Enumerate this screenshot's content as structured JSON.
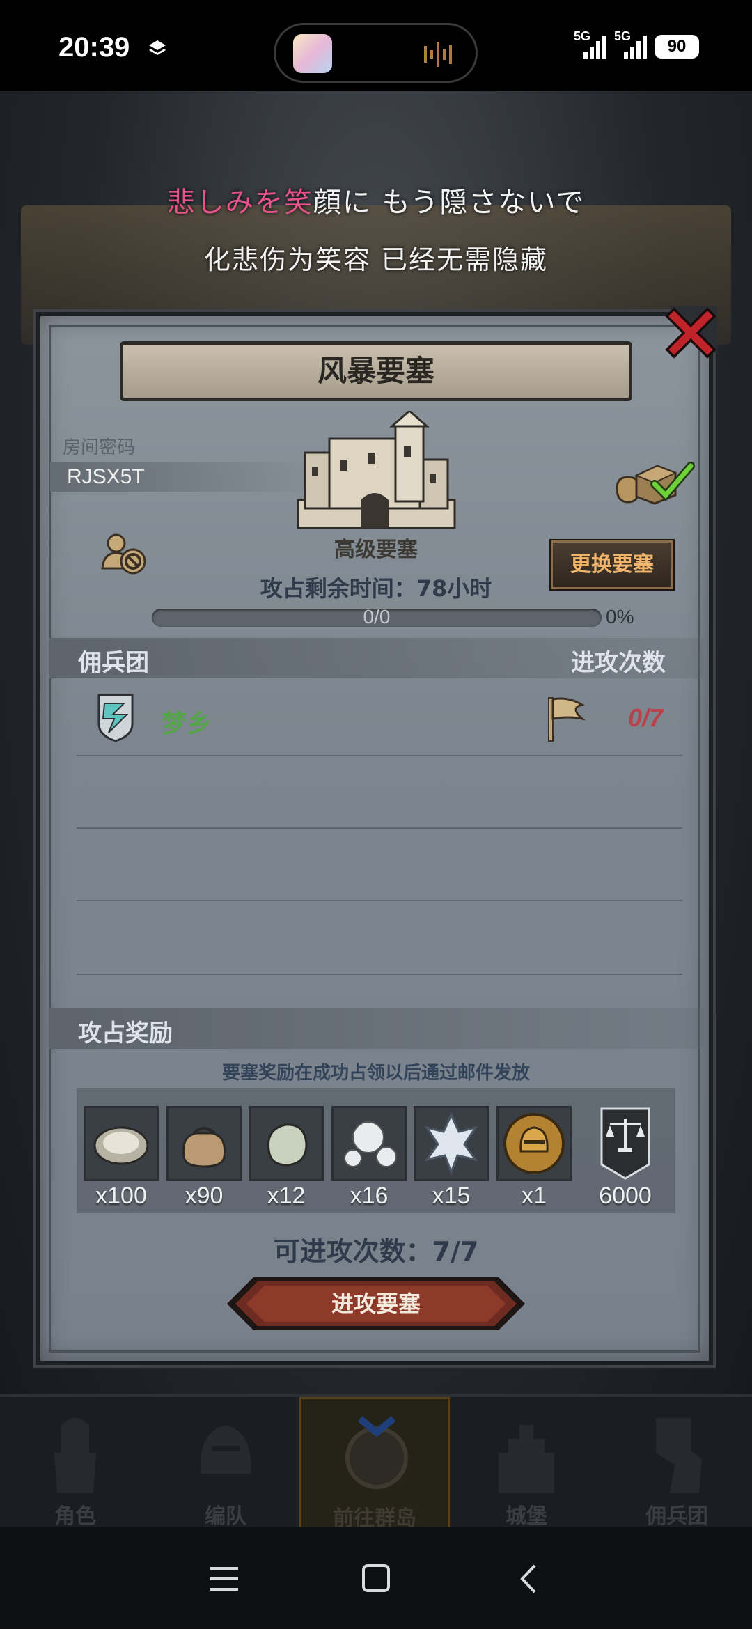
{
  "status_bar": {
    "time": "20:39",
    "network_1": "5G",
    "network_2": "5G",
    "battery": "90",
    "icons": [
      "layers-icon",
      "signal-icon",
      "signal-icon",
      "battery-icon"
    ]
  },
  "lyrics": {
    "line1_highlight": "悲しみを笑",
    "line1_rest": "顔に もう隠さないで",
    "line2": "化悲伤为笑容 已经无需隐藏"
  },
  "dialog": {
    "title": "风暴要塞",
    "room_label": "房间密码",
    "room_code": "RJSX5T",
    "fortress_level": "高级要塞",
    "time_left": "攻占剩余时间：78小时",
    "change_button": "更换要塞",
    "progress_text": "0/0",
    "progress_fraction": 0,
    "progress_pct": "0%",
    "mercenary_header": "佣兵团",
    "attacks_header": "进攻次数",
    "guild": {
      "name": "梦乡",
      "attacks": "0/7"
    },
    "reward_header": "攻占奖励",
    "reward_note": "要塞奖励在成功占领以后通过邮件发放",
    "rewards": [
      {
        "icon": "oyster-icon",
        "qty": "x100"
      },
      {
        "icon": "sack-icon",
        "qty": "x90"
      },
      {
        "icon": "jade-stone-icon",
        "qty": "x12"
      },
      {
        "icon": "pearls-icon",
        "qty": "x16"
      },
      {
        "icon": "crystal-shard-icon",
        "qty": "x15"
      },
      {
        "icon": "knight-helmet-coin-icon",
        "qty": "x1"
      },
      {
        "icon": "scales-banner-icon",
        "qty": "6000"
      }
    ],
    "remaining_attacks": "可进攻次数：7/7",
    "attack_button": "进攻要塞"
  },
  "game_nav": {
    "items": [
      {
        "label": "角色",
        "icon": "knight-icon"
      },
      {
        "label": "编队",
        "icon": "helmet-icon"
      },
      {
        "label": "前往群岛",
        "icon": "globe-compass-icon",
        "active": true
      },
      {
        "label": "城堡",
        "icon": "castle-icon"
      },
      {
        "label": "佣兵团",
        "icon": "banner-knight-icon"
      }
    ]
  },
  "colors": {
    "accent_gold": "#f0b56a",
    "guild_green": "#55a34a",
    "attack_red": "#b8424a",
    "close_red": "#c0242a"
  }
}
